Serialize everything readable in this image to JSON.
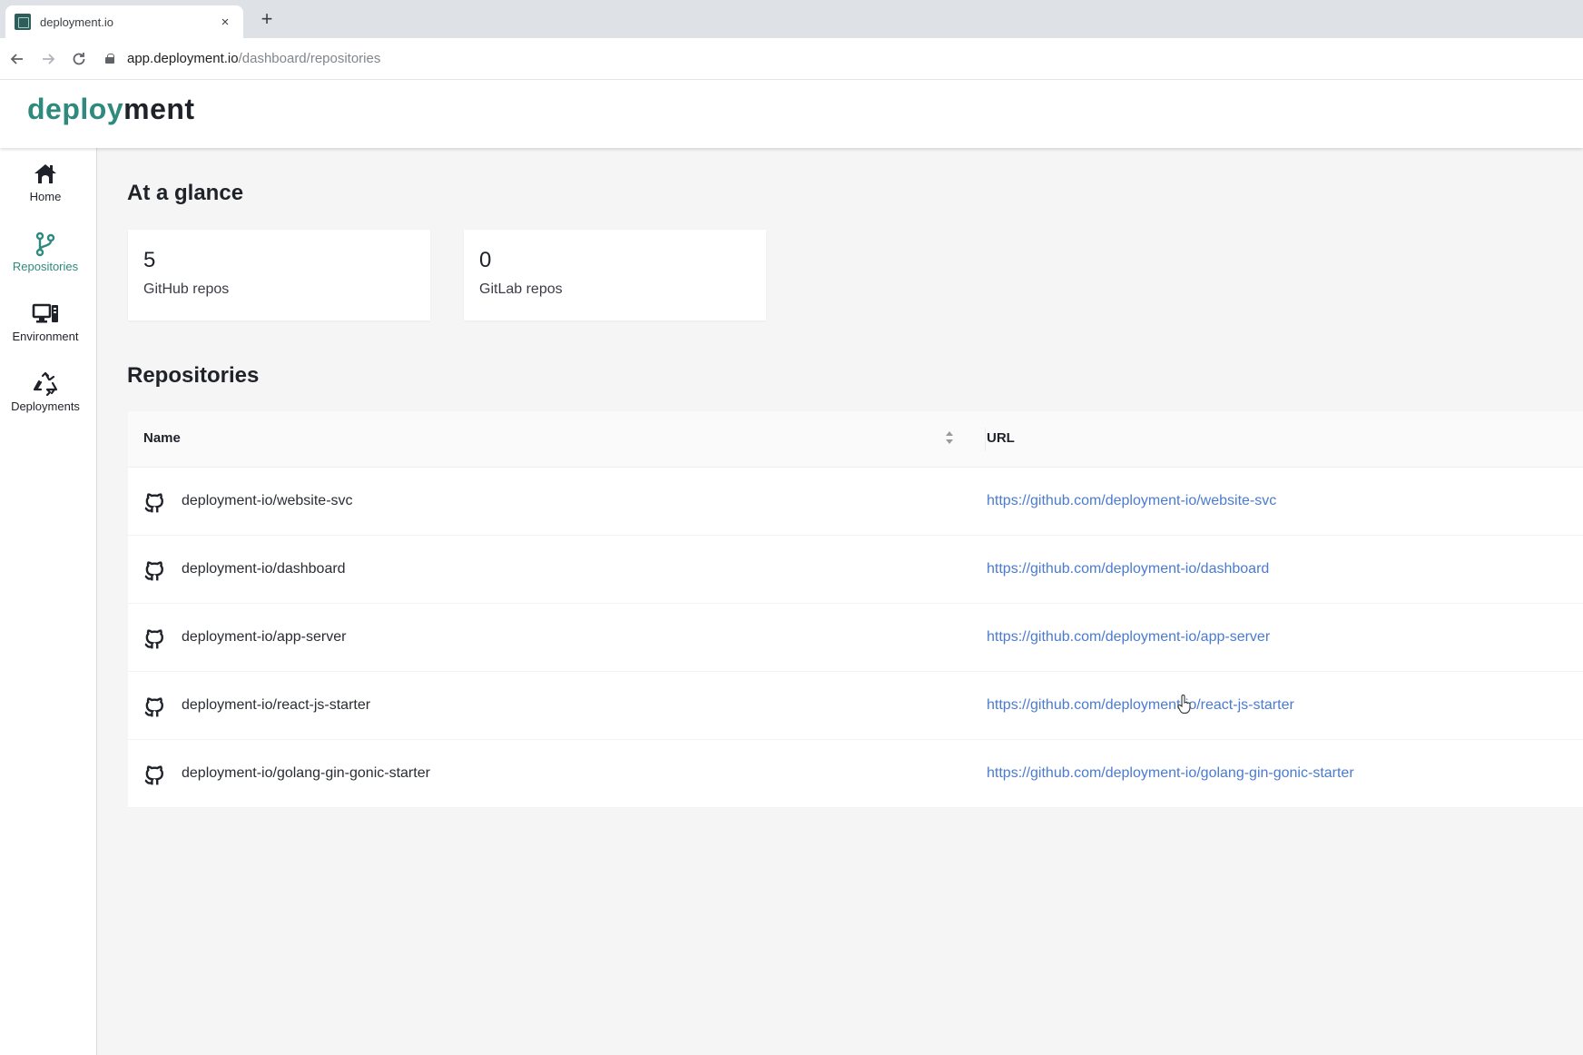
{
  "browser": {
    "tab_title": "deployment.io",
    "tab_close": "×",
    "new_tab": "+",
    "url_host": "app.deployment.io",
    "url_path": "/dashboard/repositories"
  },
  "app": {
    "logo_part1": "deploy",
    "logo_part2": "ment",
    "accent_color": "#2f8a7e",
    "link_color": "#4a7bd0"
  },
  "sidebar": {
    "items": [
      {
        "label": "Home",
        "icon": "home-icon",
        "active": false
      },
      {
        "label": "Repositories",
        "icon": "branch-icon",
        "active": true
      },
      {
        "label": "Environment",
        "icon": "devices-icon",
        "active": false
      },
      {
        "label": "Deployments",
        "icon": "recycle-icon",
        "active": false
      }
    ]
  },
  "glance": {
    "heading": "At a glance",
    "stats": [
      {
        "value": "5",
        "label": "GitHub repos"
      },
      {
        "value": "0",
        "label": "GitLab repos"
      }
    ]
  },
  "repositories": {
    "heading": "Repositories",
    "columns": [
      "Name",
      "URL"
    ],
    "rows": [
      {
        "name": "deployment-io/website-svc",
        "url": "https://github.com/deployment-io/website-svc"
      },
      {
        "name": "deployment-io/dashboard",
        "url": "https://github.com/deployment-io/dashboard"
      },
      {
        "name": "deployment-io/app-server",
        "url": "https://github.com/deployment-io/app-server"
      },
      {
        "name": "deployment-io/react-js-starter",
        "url": "https://github.com/deployment-io/react-js-starter"
      },
      {
        "name": "deployment-io/golang-gin-gonic-starter",
        "url": "https://github.com/deployment-io/golang-gin-gonic-starter"
      }
    ]
  }
}
